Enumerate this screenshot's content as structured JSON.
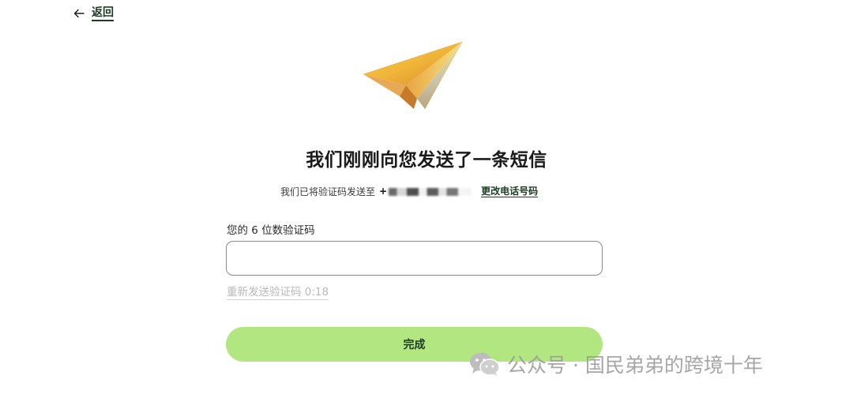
{
  "nav": {
    "back_label": "返回"
  },
  "heading": {
    "title": "我们刚刚向您发送了一条短信"
  },
  "subtitle": {
    "text": "我们已将验证码发送至",
    "phone_visible_prefix": "+",
    "change_link": "更改电话号码"
  },
  "form": {
    "code_label": "您的 6 位数验证码",
    "code_value": "",
    "resend_text": "重新发送验证码 0:18",
    "submit_label": "完成"
  },
  "watermark": {
    "text": "公众号 · 国民弟弟的跨境十年"
  },
  "icons": {
    "back": "arrow-left-icon",
    "hero": "paper-plane-icon",
    "watermark": "wechat-icon"
  },
  "colors": {
    "accent_dark": "#1c3b24",
    "button_green": "#b2e681",
    "muted": "#b9b9b9"
  }
}
